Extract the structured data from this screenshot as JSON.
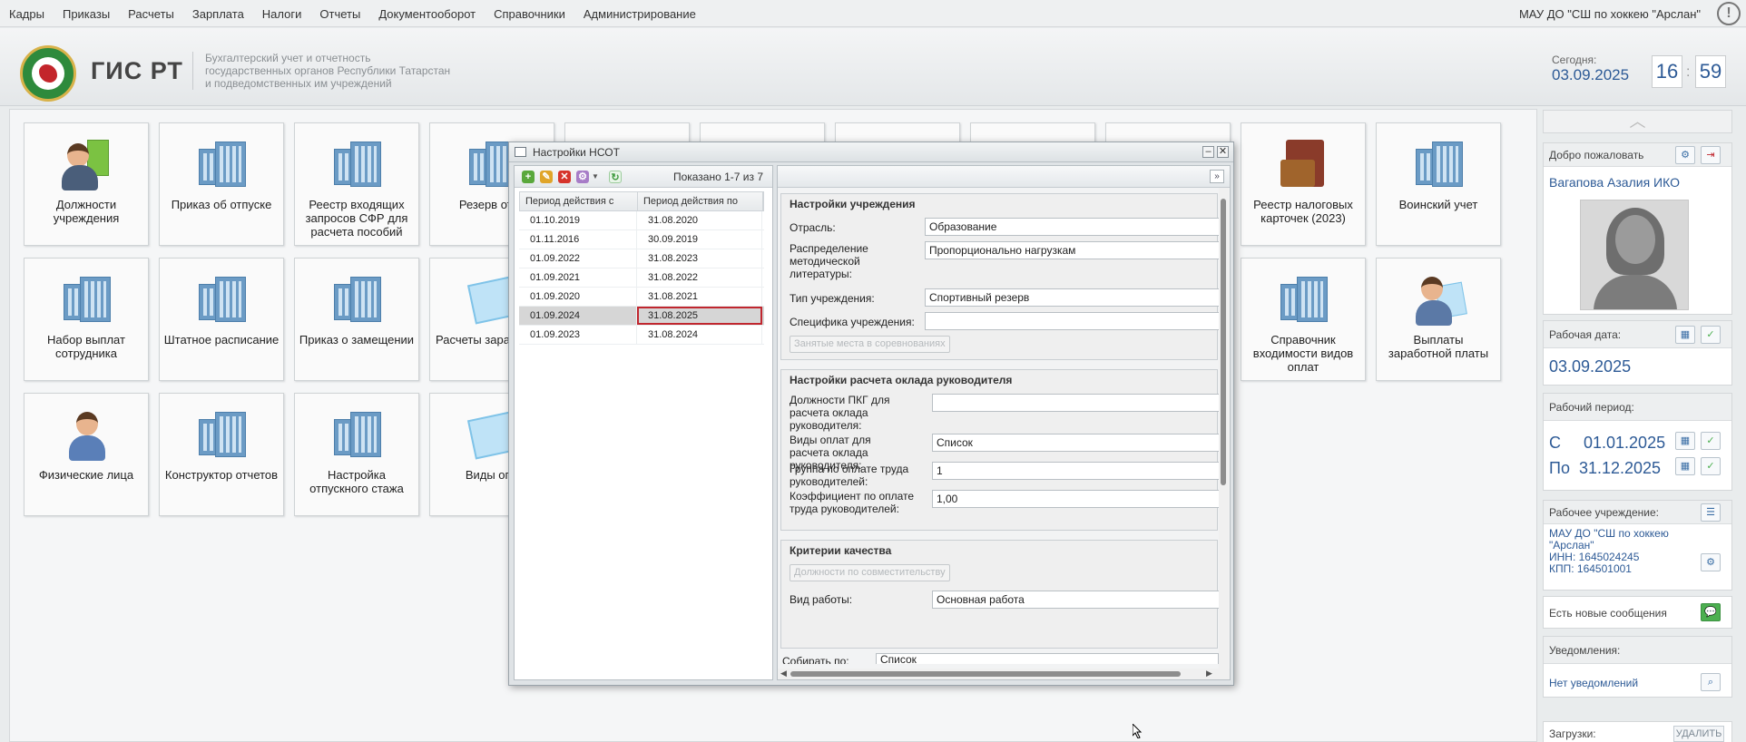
{
  "topbar": {
    "menu": [
      "Кадры",
      "Приказы",
      "Расчеты",
      "Зарплата",
      "Налоги",
      "Отчеты",
      "Документооборот",
      "Справочники",
      "Администрирование"
    ],
    "org": "МАУ ДО \"СШ по хоккею \"Арслан\"",
    "alert_glyph": "!"
  },
  "header": {
    "brand": "ГИС РТ",
    "desc_line1": "Бухгалтерский учет и отчетность",
    "desc_line2": "государственных органов Республики Татарстан",
    "desc_line3": "и подведомственных им учреждений",
    "today_label": "Сегодня:",
    "today_date": "03.09.2025",
    "clock_h": "16",
    "clock_m": "59",
    "clock_sep": ":"
  },
  "tiles": [
    {
      "label": "Должности учреждения",
      "icon": "people-icon"
    },
    {
      "label": "Приказ об отпуске",
      "icon": "building-icon"
    },
    {
      "label": "Реестр входящих запросов СФР для расчета пособий",
      "icon": "building-icon"
    },
    {
      "label": "Резерв отпу",
      "icon": "building-icon"
    },
    {
      "label": "Реестр налоговых карточек (2023)",
      "icon": "wallet-icon"
    },
    {
      "label": "Воинский учет",
      "icon": "building-icon"
    },
    {
      "label": "Набор выплат сотрудника",
      "icon": "building-icon"
    },
    {
      "label": "Штатное расписание",
      "icon": "building-icon"
    },
    {
      "label": "Приказ о замещении",
      "icon": "building-icon"
    },
    {
      "label": "Расчеты заработной",
      "icon": "money-icon"
    },
    {
      "label": "Справочник входимости видов оплат",
      "icon": "building-icon"
    },
    {
      "label": "Выплаты заработной платы",
      "icon": "person-money-icon"
    },
    {
      "label": "Физические лица",
      "icon": "person-icon"
    },
    {
      "label": "Конструктор отчетов",
      "icon": "building-icon"
    },
    {
      "label": "Настройка отпускного стажа",
      "icon": "building-icon"
    },
    {
      "label": "Виды опл",
      "icon": "money-icon"
    }
  ],
  "modal": {
    "title": "Настройки НСОТ",
    "minimize": "–",
    "close": "✕",
    "shown": "Показано 1-7 из 7",
    "columns": [
      "Период действия с",
      "Период действия по"
    ],
    "rows": [
      [
        "01.10.2019",
        "31.08.2020"
      ],
      [
        "01.11.2016",
        "30.09.2019"
      ],
      [
        "01.09.2022",
        "31.08.2023"
      ],
      [
        "01.09.2021",
        "31.08.2022"
      ],
      [
        "01.09.2020",
        "31.08.2021"
      ],
      [
        "01.09.2024",
        "31.08.2025"
      ],
      [
        "01.09.2023",
        "31.08.2024"
      ]
    ],
    "selected_row": 5,
    "expand_glyph": "»",
    "inst": {
      "title": "Настройки учреждения",
      "industry_label": "Отрасль:",
      "industry_value": "Образование",
      "distribution_label": "Распределение методической литературы:",
      "distribution_value": "Пропорционально нагрузкам",
      "type_label": "Тип учреждения:",
      "type_value": "Спортивный резерв",
      "spec_label": "Специфика учреждения:",
      "spec_value": "",
      "places_button": "Занятые места в соревнованиях"
    },
    "head": {
      "title": "Настройки расчета оклада руководителя",
      "pkg_label": "Должности ПКГ для расчета оклада руководителя:",
      "pkg_value": "",
      "pay_label": "Виды оплат для расчета оклада руководителя:",
      "pay_value": "Список",
      "group_label": "Группа по оплате труда руководителей:",
      "group_value": "1",
      "coef_label": "Коэффициент по оплате труда руководителей:",
      "coef_value": "1,00"
    },
    "quality": {
      "title": "Критерии качества",
      "combo_button": "Должности по совместительству",
      "work_label": "Вид работы:",
      "work_value": "Основная работа",
      "collect_label": "Собирать по:",
      "collect_value": "Список"
    }
  },
  "sidebar": {
    "collapse_glyph": "︿",
    "welcome": "Добро пожаловать",
    "user": "Вагапова Азалия ИКО",
    "work_date_label": "Рабочая дата:",
    "work_date": "03.09.2025",
    "period_label": "Рабочий период:",
    "period_from": "С     01.01.2025",
    "period_to": "По  31.12.2025",
    "inst_label": "Рабочее учреждение:",
    "inst_name": "МАУ ДО \"СШ по хоккею \"Арслан\"",
    "inst_inn": "ИНН: 1645024245",
    "inst_kpp": "КПП: 164501001",
    "messages": "Есть новые сообщения",
    "notif_label": "Уведомления:",
    "notif_value": "Нет уведомлений",
    "downloads_label": "Загрузки:",
    "delete_button": "УДАЛИТЬ"
  },
  "colors": {
    "accent": "#2d5a96",
    "selected_cell_border": "#c0262e",
    "logo_green": "#2e8a3c"
  }
}
